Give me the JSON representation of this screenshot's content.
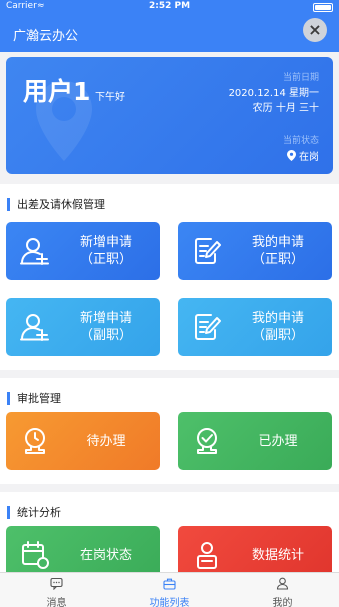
{
  "status_bar": {
    "carrier": "Carrier",
    "time": "2:52 PM"
  },
  "nav": {
    "title": "广瀚云办公",
    "close_icon": "close-icon"
  },
  "user_card": {
    "name": "用户1",
    "greeting": "下午好",
    "date_label": "当前日期",
    "date": "2020.12.14 星期一",
    "lunar": "农历 十月 三十",
    "status_label": "当前状态",
    "status": "在岗"
  },
  "sections": [
    {
      "title": "出差及请休假管理",
      "tiles": [
        {
          "line1": "新增申请",
          "line2": "（正职）",
          "icon": "add-user-icon"
        },
        {
          "line1": "我的申请",
          "line2": "（正职）",
          "icon": "document-edit-icon"
        },
        {
          "line1": "新增申请",
          "line2": "（副职）",
          "icon": "add-user-icon"
        },
        {
          "line1": "我的申请",
          "line2": "（副职）",
          "icon": "document-edit-icon"
        }
      ]
    },
    {
      "title": "审批管理",
      "tiles": [
        {
          "line1": "待办理",
          "icon": "pending-stamp-icon"
        },
        {
          "line1": "已办理",
          "icon": "approved-stamp-icon"
        }
      ]
    },
    {
      "title": "统计分析",
      "tiles": [
        {
          "line1": "在岗状态",
          "icon": "calendar-clock-icon"
        },
        {
          "line1": "数据统计",
          "icon": "user-report-icon"
        }
      ]
    }
  ],
  "tabs": [
    {
      "label": "消息",
      "icon": "message-icon",
      "active": false
    },
    {
      "label": "功能列表",
      "icon": "briefcase-icon",
      "active": true
    },
    {
      "label": "我的",
      "icon": "profile-icon",
      "active": false
    }
  ],
  "colors": {
    "primary": "#3b82f6",
    "tile_blue": "#3b86f4",
    "tile_sky": "#45b6f2",
    "tile_orange": "#f79a32",
    "tile_green": "#4ec06a",
    "tile_red": "#f14a3e"
  }
}
